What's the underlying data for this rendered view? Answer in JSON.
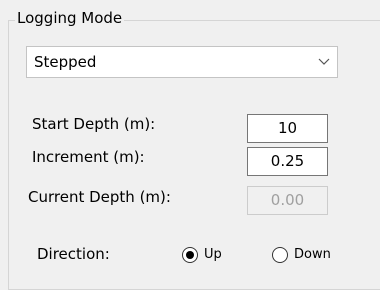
{
  "group": {
    "title": "Logging Mode"
  },
  "mode_select": {
    "value": "Stepped"
  },
  "fields": {
    "start_depth": {
      "label": "Start Depth (m):",
      "value": "10"
    },
    "increment": {
      "label": "Increment (m):",
      "value": "0.25"
    },
    "current_depth": {
      "label": "Current Depth (m):",
      "value": "0.00"
    }
  },
  "direction": {
    "label": "Direction:",
    "options": [
      {
        "label": "Up",
        "selected": true
      },
      {
        "label": "Down",
        "selected": false
      }
    ]
  }
}
